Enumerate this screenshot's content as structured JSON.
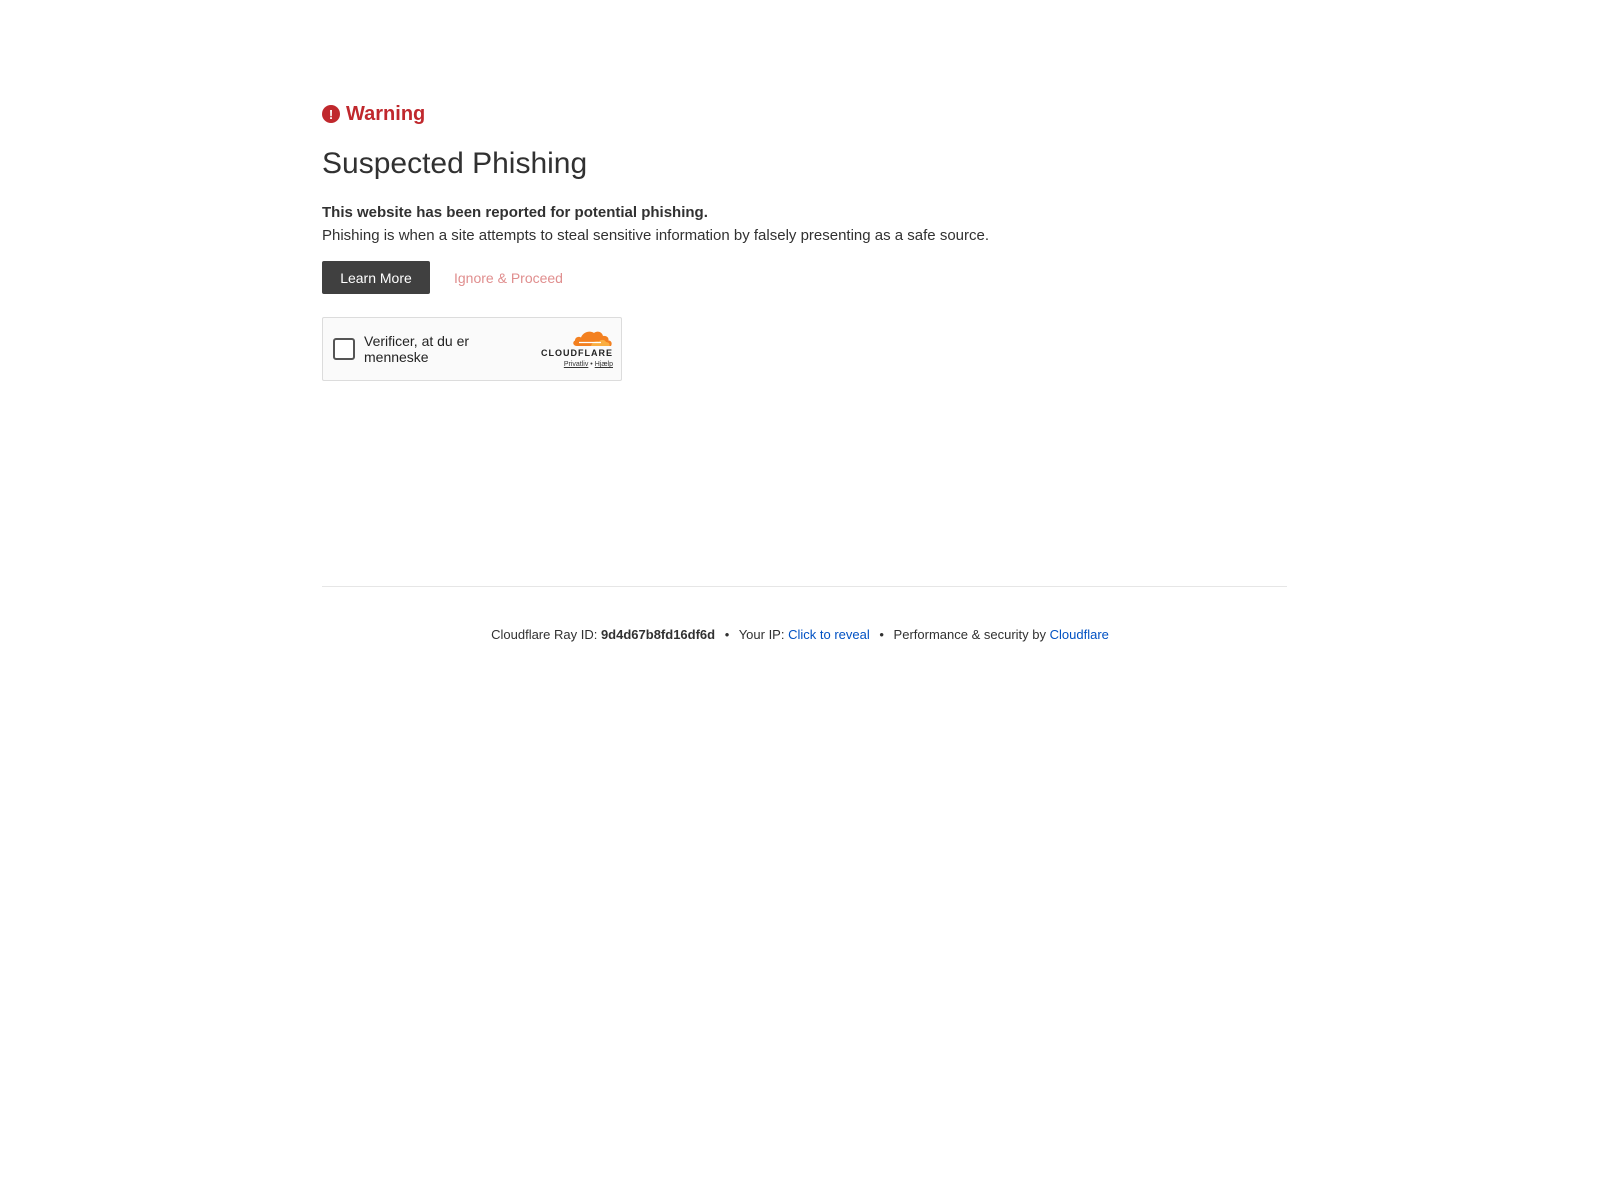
{
  "warning": {
    "icon": "exclamation-circle-icon",
    "icon_glyph": "!",
    "label": "Warning",
    "color": "#c0282d"
  },
  "title": "Suspected Phishing",
  "lead": "This website has been reported for potential phishing.",
  "description": "Phishing is when a site attempts to steal sensitive information by falsely presenting as a safe source.",
  "actions": {
    "learn_more": "Learn More",
    "ignore_proceed": "Ignore & Proceed"
  },
  "turnstile": {
    "checkbox_label": "Verificer, at du er menneske",
    "brand": "CLOUDFLARE",
    "brand_icon": "cloudflare-cloud-icon",
    "privacy_link": "Privatliv",
    "separator": "•",
    "help_link": "Hjælp"
  },
  "footer": {
    "ray_label": "Cloudflare Ray ID:",
    "ray_id": "9d4d67b8fd16df6d",
    "bullet": "•",
    "ip_label": "Your IP:",
    "ip_link": "Click to reveal",
    "perf_label": "Performance & security by",
    "cf_link": "Cloudflare",
    "link_color": "#0051c3"
  }
}
